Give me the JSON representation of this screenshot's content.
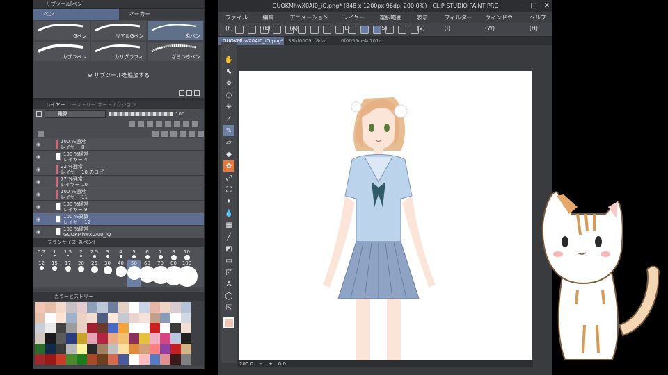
{
  "subtool_panel": {
    "title": "サブツール[ペン]",
    "tabs": [
      {
        "label": "ペン",
        "selected": true
      },
      {
        "label": "マーカー",
        "selected": false
      }
    ],
    "brushes": [
      {
        "label": "Gペン"
      },
      {
        "label": "リアルGペン"
      },
      {
        "label": "丸ペン",
        "selected": true
      },
      {
        "label": "カブラペン"
      },
      {
        "label": "カリグラフィ"
      },
      {
        "label": "ざらつきペン"
      }
    ],
    "add_subtool": "サブツールを追加する"
  },
  "layer_panel": {
    "tabs": [
      "レイヤー",
      "ユーストリー",
      "オートアクション"
    ],
    "blend_mode": "乗算",
    "opacity": "100",
    "layers": [
      {
        "line1": "100 %通常",
        "line2": "レイヤー 8",
        "mark": "red"
      },
      {
        "line1": "100 %通常",
        "line2": "レイヤー 4",
        "mark": "thumb"
      },
      {
        "line1": "22 %通常",
        "line2": "レイヤー 10 のコピー",
        "mark": "red"
      },
      {
        "line1": "77 %通常",
        "line2": "レイヤー 10",
        "mark": "red"
      },
      {
        "line1": "100 %通常",
        "line2": "レイヤー 11",
        "mark": "red"
      },
      {
        "line1": "100 %通常",
        "line2": "レイヤー 9",
        "mark": "thumb"
      },
      {
        "line1": "100 %乗算",
        "line2": "レイヤー 12",
        "mark": "thumb",
        "selected": true
      },
      {
        "line1": "100 %通常",
        "line2": "GUOKMhwX0AI0_iQ",
        "mark": "thumb"
      }
    ]
  },
  "brush_size_panel": {
    "title": "ブラシサイズ[丸ペン]",
    "sizes": [
      {
        "label": "0.7",
        "dot": 1
      },
      {
        "label": "1",
        "dot": 1
      },
      {
        "label": "1.5",
        "dot": 1
      },
      {
        "label": "2",
        "dot": 1.5
      },
      {
        "label": "2.5",
        "dot": 2
      },
      {
        "label": "3",
        "dot": 2
      },
      {
        "label": "4",
        "dot": 2
      },
      {
        "label": "5",
        "dot": 2.5
      },
      {
        "label": "6",
        "dot": 3
      },
      {
        "label": "7",
        "dot": 3
      },
      {
        "label": "8",
        "dot": 4
      },
      {
        "label": "10",
        "dot": 4
      },
      {
        "label": "12",
        "dot": 3
      },
      {
        "label": "15",
        "dot": 3.5
      },
      {
        "label": "17",
        "dot": 4
      },
      {
        "label": "20",
        "dot": 4.5
      },
      {
        "label": "25",
        "dot": 5
      },
      {
        "label": "30",
        "dot": 6
      },
      {
        "label": "40",
        "dot": 8
      },
      {
        "label": "50",
        "dot": 10,
        "selected": true
      },
      {
        "label": "60",
        "dot": 12
      },
      {
        "label": "70",
        "dot": 13
      },
      {
        "label": "80",
        "dot": 14
      },
      {
        "label": "100",
        "dot": 15
      }
    ]
  },
  "color_history": {
    "title": "カラーヒストリー",
    "colors": [
      "#f2c6b4",
      "#e7bfa9",
      "#f4d8c8",
      "#c7c0c4",
      "#e3cdd0",
      "#8ea0b8",
      "#bcc7d8",
      "#6d7f9d",
      "#e4d1c4",
      "#ffffff",
      "#c9d4e6",
      "#e6b7a4",
      "#efd4c7",
      "#d6ccd2",
      "#b7c4d8",
      "#e5c1ad",
      "#ffffff",
      "#fbe3d5",
      "#a0b2c9",
      "#ecd2c6",
      "#f1ddd4",
      "#4d5f82",
      "#ffe7d9",
      "#c4c9d3",
      "#e9d4cf",
      "#f5e3da",
      "#c3a08a",
      "#8a9bb7",
      "#ffffff",
      "#d3d9e3",
      "#c8cfd9",
      "#eaeaea",
      "#444444",
      "#9c9c9c",
      "#e8d0c4",
      "#a02030",
      "#6b3a2a",
      "#4a68c6",
      "#f5a33a",
      "#ffffff",
      "#ffffff",
      "#cc2020",
      "#ffffff",
      "#3b3b3b",
      "#f3e0d4",
      "#d2c8c0",
      "#1a1a1a",
      "#5a5a5a",
      "#2a3d80",
      "#c9a428",
      "#e6a3b6",
      "#b42244",
      "#ebaa84",
      "#f0c070",
      "#8a3060",
      "#e6c23a",
      "#ecb0c4",
      "#d64580",
      "#b8c8e0",
      "#202020",
      "#2a6a2a",
      "#102a4a",
      "#3a3a3a",
      "#b8b8b8",
      "#fff4a0",
      "#2a2a2a",
      "#a08060",
      "#c0c0c0",
      "#ffe0a0",
      "#e08a40",
      "#d2a078",
      "#ff8080",
      "#9040a0",
      "#c02020",
      "#d4b486",
      "#a0282c",
      "#9a1818",
      "#c83c28",
      "#4a8a2a",
      "#1e7a1e",
      "#a84a2a",
      "#6a4020",
      "#d46a50",
      "#4a5a9a",
      "#ffffff",
      "#ffbcbc",
      "#5a7ac0",
      "#e09090",
      "#3a1a1a",
      "#808080"
    ]
  },
  "window": {
    "title": "GUOKMhwX0AI0_iQ.png* (848 x 1200px 96dpi 200.0%) - CLIP STUDIO PAINT PRO",
    "controls": [
      "–",
      "□",
      "✕"
    ]
  },
  "menu": [
    "ファイル(F)",
    "編集(E)",
    "アニメーション(A)",
    "レイヤー(L)",
    "選択範囲(S)",
    "表示(V)",
    "フィルター(I)",
    "ウィンドウ(W)",
    "ヘルプ(H)"
  ],
  "doc_tabs": [
    {
      "label": "GUOKMhwX0AI0_iQ.png*",
      "selected": true
    },
    {
      "label": "33bf0009cf8daf"
    },
    {
      "label": "0f0055ce4c701a"
    }
  ],
  "status": {
    "zoom": "200.0",
    "angle": "0.0"
  },
  "tools": [
    {
      "name": "zoom-tool-icon",
      "glyph": "⌕"
    },
    {
      "name": "hand-tool-icon",
      "glyph": "✋"
    },
    {
      "name": "operation-tool-icon",
      "glyph": "⬉"
    },
    {
      "name": "move-tool-icon",
      "glyph": "✥"
    },
    {
      "name": "lasso-tool-icon",
      "glyph": "◌"
    },
    {
      "name": "wand-tool-icon",
      "glyph": "✳"
    },
    {
      "name": "eyedropper-tool-icon",
      "glyph": "⁄"
    },
    {
      "name": "pen-tool-icon",
      "glyph": "✎",
      "selected": true
    },
    {
      "name": "eraser-tool-icon",
      "glyph": "▱"
    },
    {
      "name": "fill-tool-icon",
      "glyph": "◆"
    },
    {
      "name": "decoration-tool-icon",
      "glyph": "✿",
      "orange": true
    },
    {
      "name": "airbrush-tool-icon",
      "glyph": "⤢"
    },
    {
      "name": "stamp-tool-icon",
      "glyph": "⛶"
    },
    {
      "name": "blend-tool-icon",
      "glyph": "✦"
    },
    {
      "name": "drop-tool-icon",
      "glyph": "💧"
    },
    {
      "name": "grid-tool-icon",
      "glyph": "▦"
    },
    {
      "name": "line-tool-icon",
      "glyph": "╱"
    },
    {
      "name": "gradient-tool-icon",
      "glyph": "◩"
    },
    {
      "name": "frame-tool-icon",
      "glyph": "▭"
    },
    {
      "name": "ruler-tool-icon",
      "glyph": "◸"
    },
    {
      "name": "text-tool-icon",
      "glyph": "A"
    },
    {
      "name": "balloon-tool-icon",
      "glyph": "◯"
    },
    {
      "name": "correct-line-tool-icon",
      "glyph": "⇱"
    }
  ]
}
